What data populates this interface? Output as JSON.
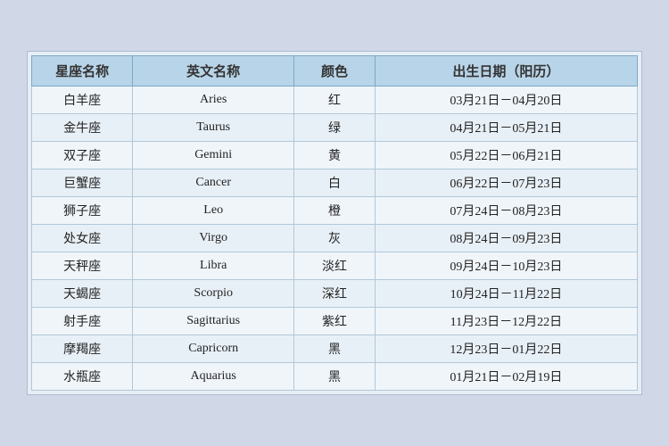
{
  "table": {
    "headers": {
      "chinese_name": "星座名称",
      "english_name": "英文名称",
      "color": "颜色",
      "birth_date": "出生日期（阳历）"
    },
    "rows": [
      {
        "chinese": "白羊座",
        "english": "Aries",
        "color": "红",
        "date": "03月21日－04月20日"
      },
      {
        "chinese": "金牛座",
        "english": "Taurus",
        "color": "绿",
        "date": "04月21日－05月21日"
      },
      {
        "chinese": "双子座",
        "english": "Gemini",
        "color": "黄",
        "date": "05月22日－06月21日"
      },
      {
        "chinese": "巨蟹座",
        "english": "Cancer",
        "color": "白",
        "date": "06月22日－07月23日"
      },
      {
        "chinese": "狮子座",
        "english": "Leo",
        "color": "橙",
        "date": "07月24日－08月23日"
      },
      {
        "chinese": "处女座",
        "english": "Virgo",
        "color": "灰",
        "date": "08月24日－09月23日"
      },
      {
        "chinese": "天秤座",
        "english": "Libra",
        "color": "淡红",
        "date": "09月24日－10月23日"
      },
      {
        "chinese": "天蝎座",
        "english": "Scorpio",
        "color": "深红",
        "date": "10月24日－11月22日"
      },
      {
        "chinese": "射手座",
        "english": "Sagittarius",
        "color": "紫红",
        "date": "11月23日－12月22日"
      },
      {
        "chinese": "摩羯座",
        "english": "Capricorn",
        "color": "黑",
        "date": "12月23日－01月22日"
      },
      {
        "chinese": "水瓶座",
        "english": "Aquarius",
        "color": "黑",
        "date": "01月21日－02月19日"
      }
    ]
  }
}
